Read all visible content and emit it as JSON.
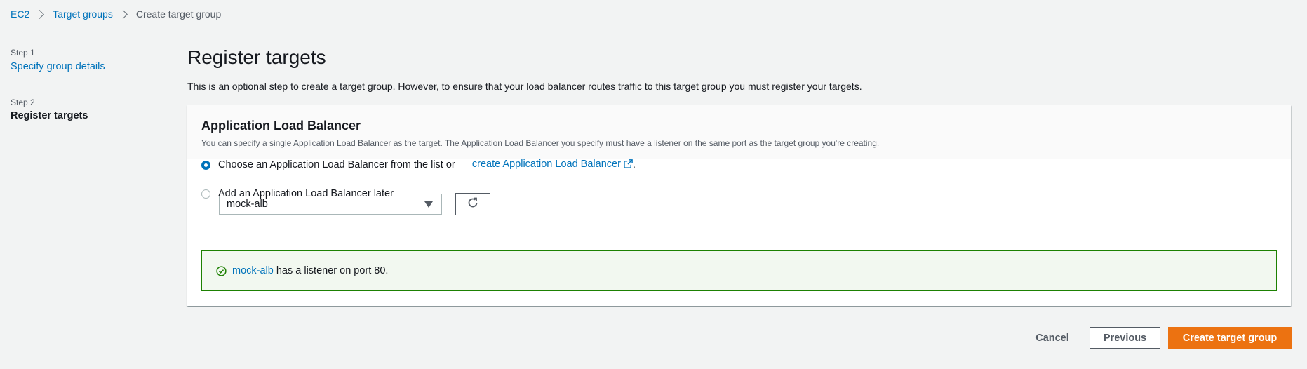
{
  "breadcrumb": {
    "items": [
      "EC2",
      "Target groups"
    ],
    "current": "Create target group"
  },
  "steps": [
    {
      "label": "Step 1",
      "title": "Specify group details"
    },
    {
      "label": "Step 2",
      "title": "Register targets"
    }
  ],
  "main": {
    "title": "Register targets",
    "description": "This is an optional step to create a target group. However, to ensure that your load balancer routes traffic to this target group you must register your targets."
  },
  "panel": {
    "title": "Application Load Balancer",
    "subtitle": "You can specify a single Application Load Balancer as the target. The Application Load Balancer you specify must have a listener on the same port as the target group you're creating.",
    "option1_text": "Choose an Application Load Balancer from the list or ",
    "option1_link": "create Application Load Balancer",
    "option1_suffix": ".",
    "select_value": "mock-alb",
    "option2_text": "Add an Application Load Balancer later",
    "alert_link": "mock-alb",
    "alert_text": " has a listener on port 80."
  },
  "footer": {
    "cancel": "Cancel",
    "previous": "Previous",
    "create": "Create target group"
  },
  "colors": {
    "link": "#0073bb",
    "primary": "#ec7211",
    "success": "#1d8102"
  },
  "icons": [
    "chevron-right-icon",
    "external-link-icon",
    "caret-down-icon",
    "refresh-icon",
    "check-circle-icon"
  ]
}
